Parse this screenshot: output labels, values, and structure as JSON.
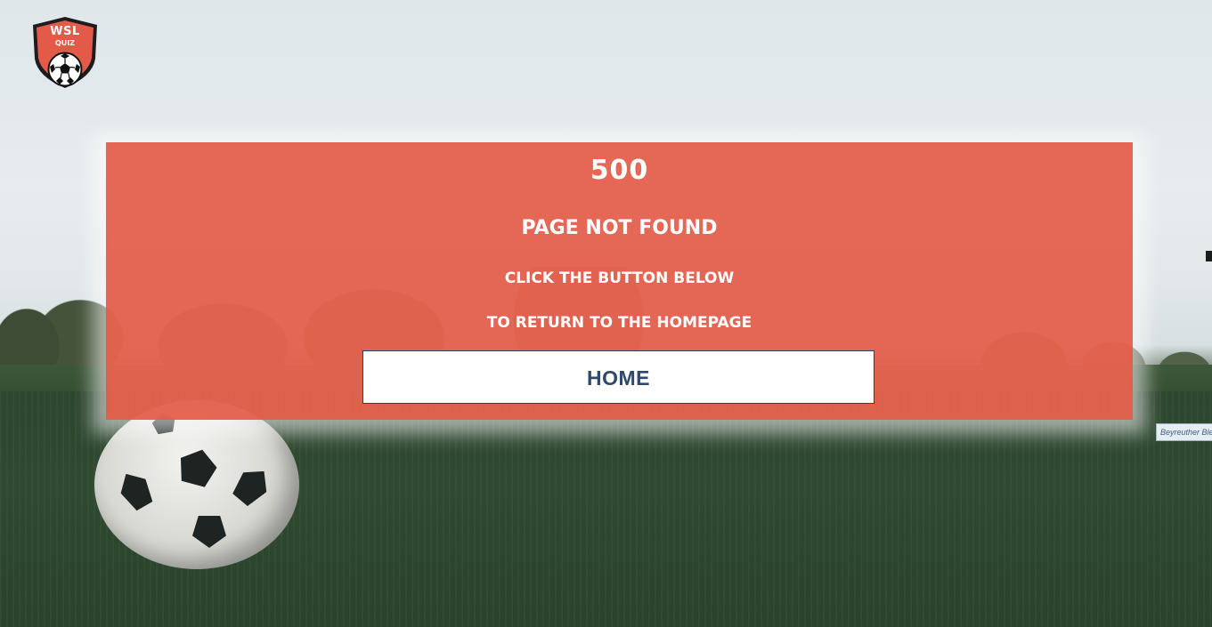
{
  "brand": {
    "logo_line1": "WSL",
    "logo_line2": "QUIZ",
    "accent_color": "#e35b48"
  },
  "error": {
    "code": "500",
    "title": "PAGE NOT FOUND",
    "line1": "CLICK THE BUTTON BELOW",
    "line2": "TO RETURN TO THE HOMEPAGE",
    "home_label": "HOME"
  },
  "background": {
    "ad_board_text": "Beyreuther Blech"
  },
  "icons": [
    "soccer-ball-icon",
    "shield-icon"
  ]
}
